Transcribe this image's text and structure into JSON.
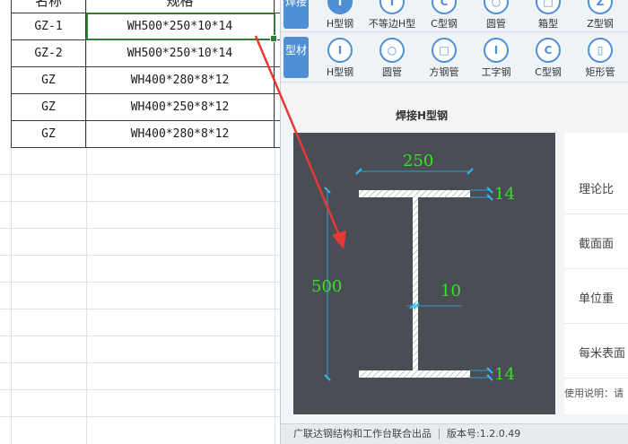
{
  "sheet": {
    "header": {
      "col1": "名称",
      "col2": "规格"
    },
    "rows": [
      {
        "name": "GZ-1",
        "spec": "WH500*250*10*14"
      },
      {
        "name": "GZ-2",
        "spec": "WH500*250*10*14"
      },
      {
        "name": "GZ",
        "spec": "WH400*280*8*12"
      },
      {
        "name": "GZ",
        "spec": "WH400*250*8*12"
      },
      {
        "name": "GZ",
        "spec": "WH400*280*8*12"
      }
    ]
  },
  "toolbar": {
    "weld_group": "焊接",
    "weld_tools": [
      "H型钢",
      "不等边H型",
      "C型钢",
      "圆管",
      "箱型",
      "Z型钢"
    ],
    "profile_group": "型材",
    "profile_tools": [
      "H型钢",
      "圆管",
      "方钢管",
      "工字钢",
      "C型钢",
      "矩形管"
    ]
  },
  "section_title": "焊接H型钢",
  "drawing": {
    "width_label": "250",
    "height_label": "500",
    "web_label": "10",
    "top_flange_label": "14",
    "bottom_flange_label": "14"
  },
  "props": [
    "理论比",
    "截面面",
    "单位重",
    "每米表面"
  ],
  "usage_text": "使用说明：请",
  "status": {
    "credit": "广联达钢结构和工作台联合出品",
    "version": "版本号:1.2.0.49"
  },
  "colors": {
    "accent": "#4f8fd6",
    "dim_green": "#39e02a",
    "dim_cyan": "#2fb7f0",
    "arrow_red": "#e53935",
    "selection_green": "#2e7d32"
  }
}
